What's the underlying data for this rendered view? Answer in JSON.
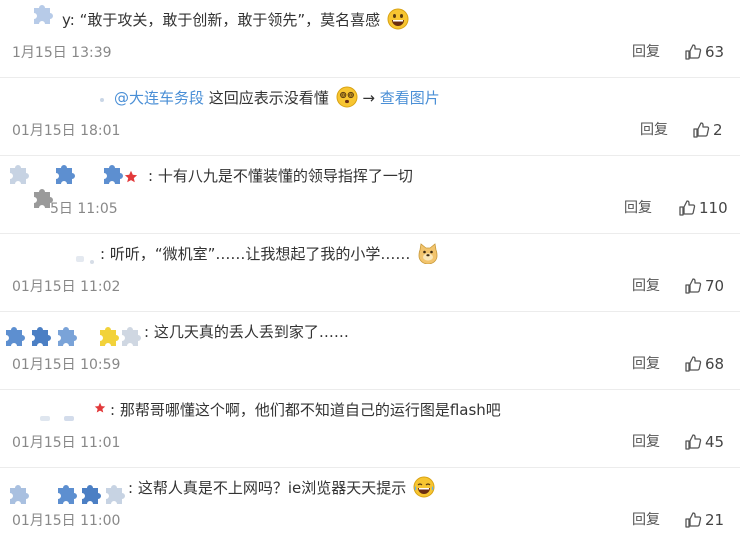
{
  "comments": [
    {
      "name_tail": "y:",
      "text": "“敢于攻关，敢于创新，敢于领先”，莫名喜感",
      "emoji": "grinning-face-emoji",
      "time": "1月15日 13:39",
      "reply": "回复",
      "likes": "63"
    },
    {
      "mention": "@大连车务段",
      "text": "这回应表示没看懂",
      "emoji": "dizzy-face-emoji",
      "arrow": "→",
      "link": "查看图片",
      "time": "01月15日 18:01",
      "reply": "回复",
      "likes": "2"
    },
    {
      "name_tail": ":",
      "text": "十有八九是不懂装懂的领导指挥了一切",
      "time": "5日 11:05",
      "reply": "回复",
      "likes": "110"
    },
    {
      "name_tail": ":",
      "text": "听听，“微机室”……让我想起了我的小学……",
      "emoji": "doge-emoji",
      "time": "01月15日 11:02",
      "reply": "回复",
      "likes": "70"
    },
    {
      "name_tail": ":",
      "text": "这几天真的丢人丢到家了……",
      "time": "01月15日 10:59",
      "reply": "回复",
      "likes": "68"
    },
    {
      "name_tail": ":",
      "text": "那帮哥哪懂这个啊，他们都不知道自己的运行图是flash吧",
      "time": "01月15日 11:01",
      "reply": "回复",
      "likes": "45"
    },
    {
      "name_tail": ":",
      "text": "这帮人真是不上网吗？ie浏览器天天提示",
      "emoji": "tears-of-joy-emoji",
      "time": "01月15日 11:00",
      "reply": "回复",
      "likes": "21"
    }
  ]
}
